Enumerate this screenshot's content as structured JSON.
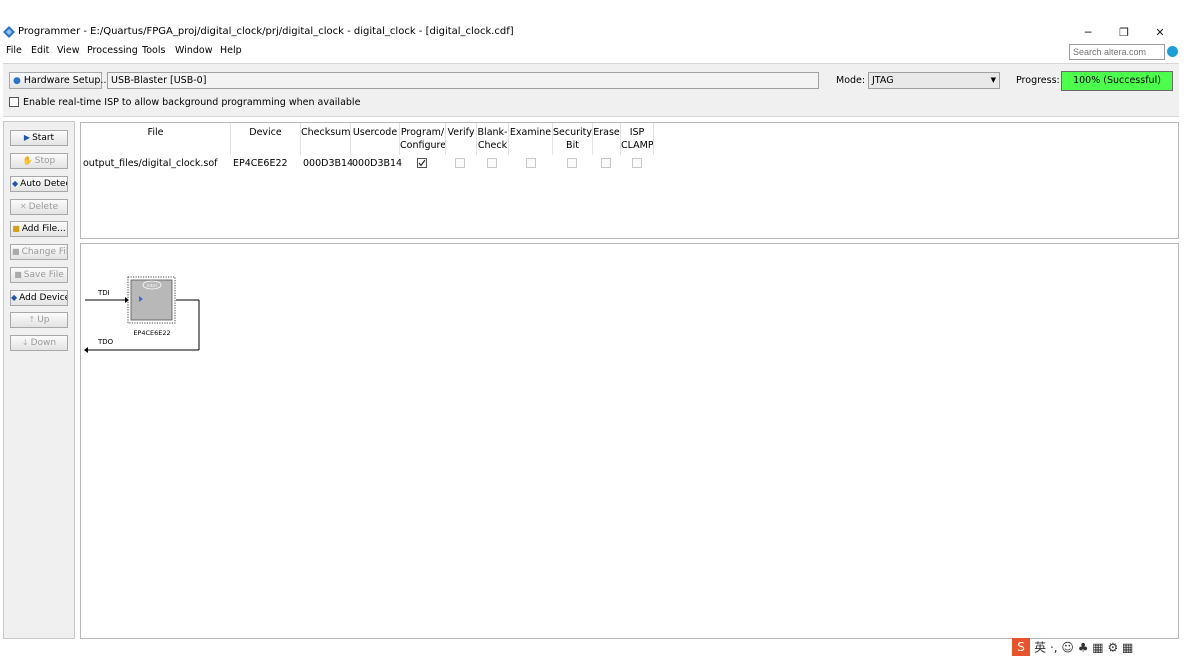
{
  "window": {
    "title": "Programmer - E:/Quartus/FPGA_proj/digital_clock/prj/digital_clock - digital_clock - [digital_clock.cdf]",
    "controls": {
      "minimize": "─",
      "maximize": "❐",
      "close": "✕"
    }
  },
  "menu": {
    "file": "File",
    "edit": "Edit",
    "view": "View",
    "processing": "Processing",
    "tools": "Tools",
    "window": "Window",
    "help": "Help"
  },
  "search": {
    "placeholder": "Search altera.com"
  },
  "hardware": {
    "setup_label": "Hardware Setup...",
    "device": "USB-Blaster [USB-0]",
    "mode_label": "Mode:",
    "mode_value": "JTAG",
    "progress_label": "Progress:",
    "progress_text": "100% (Successful)",
    "progress_fraction": 1.0,
    "isp_label": "Enable real-time ISP to allow background programming when available",
    "isp_checked": false
  },
  "sidebar": {
    "start": "Start",
    "stop": "Stop",
    "auto_detect": "Auto Detec",
    "delete": "Delete",
    "add_file": "Add File...",
    "change_file": "Change File",
    "save_file": "Save File",
    "add_device": "Add Device",
    "up": "Up",
    "down": "Down"
  },
  "table": {
    "headers": {
      "file": "File",
      "device": "Device",
      "checksum": "Checksum",
      "usercode": "Usercode",
      "program_1": "Program/",
      "program_2": "Configure",
      "verify": "Verify",
      "blank_1": "Blank-",
      "blank_2": "Check",
      "examine": "Examine",
      "security_1": "Security",
      "security_2": "Bit",
      "erase": "Erase",
      "isp_1": "ISP",
      "isp_2": "CLAMP"
    },
    "rows": [
      {
        "file": "output_files/digital_clock.sof",
        "device": "EP4CE6E22",
        "checksum": "000D3B14",
        "usercode": "000D3B14",
        "program": true,
        "verify": false,
        "blank_check": false,
        "examine": false,
        "security_bit": false,
        "erase": false,
        "isp_clamp": false
      }
    ]
  },
  "chain": {
    "tdi": "TDI",
    "tdo": "TDO",
    "device_label": "EP4CE6E22",
    "chip_logo": "intel"
  },
  "ime": {
    "text": "英 ·, ☺ ♣ ▦ ⚙ ▦"
  },
  "colors": {
    "progress_fill": "#4cff4c",
    "panel_bg": "#f0f0f0",
    "chip_fill": "#b8b8b8",
    "arrow_blue": "#3a6fd0"
  }
}
